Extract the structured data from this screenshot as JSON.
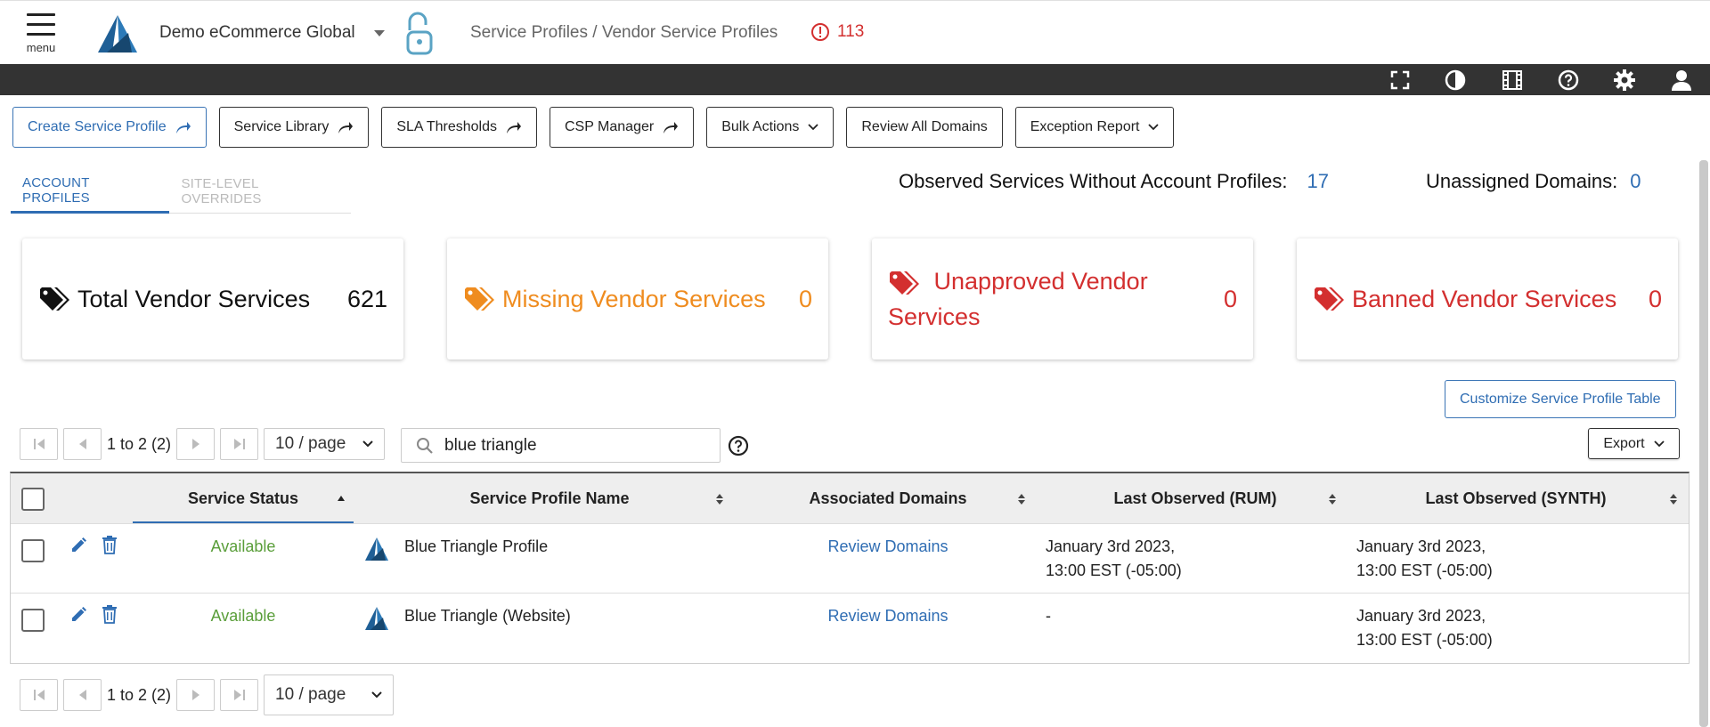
{
  "header": {
    "menu_label": "menu",
    "org_name": "Demo eCommerce Global",
    "breadcrumb": "Service Profiles / Vendor Service Profiles",
    "alert_count": "113",
    "icons": [
      "fullscreen-icon",
      "contrast-icon",
      "film-icon",
      "help-icon",
      "settings-icon",
      "user-icon"
    ]
  },
  "toolbar": {
    "create": "Create Service Profile",
    "library": "Service Library",
    "sla": "SLA Thresholds",
    "csp": "CSP Manager",
    "bulk": "Bulk Actions",
    "review_all": "Review All Domains",
    "exception": "Exception Report"
  },
  "tabs": {
    "account": "ACCOUNT PROFILES",
    "site": "SITE-LEVEL OVERRIDES"
  },
  "summary": {
    "observed_label": "Observed Services Without Account Profiles:",
    "observed_value": "17",
    "unassigned_label": "Unassigned Domains:",
    "unassigned_value": "0"
  },
  "cards": {
    "total": {
      "label": "Total Vendor Services",
      "value": "621"
    },
    "missing": {
      "label": "Missing Vendor Services",
      "value": "0"
    },
    "unapproved": {
      "label": "Unapproved Vendor Services",
      "value": "0"
    },
    "banned": {
      "label": "Banned Vendor Services",
      "value": "0"
    }
  },
  "customize_label": "Customize Service Profile Table",
  "pager": {
    "range": "1 to 2 (2)",
    "page_size": "10 / page"
  },
  "search": {
    "value": "blue triangle"
  },
  "export_label": "Export",
  "table": {
    "columns": {
      "status": "Service Status",
      "name": "Service Profile Name",
      "domains": "Associated Domains",
      "rum": "Last Observed (RUM)",
      "synth": "Last Observed (SYNTH)"
    },
    "rows": [
      {
        "status": "Available",
        "name": "Blue Triangle Profile",
        "domains": "Review Domains",
        "rum_1": "January 3rd 2023,",
        "rum_2": "13:00 EST (-05:00)",
        "synth_1": "January 3rd 2023,",
        "synth_2": "13:00 EST (-05:00)"
      },
      {
        "status": "Available",
        "name": "Blue Triangle (Website)",
        "domains": "Review Domains",
        "rum_1": "-",
        "rum_2": "",
        "synth_1": "January 3rd 2023,",
        "synth_2": "13:00 EST (-05:00)"
      }
    ]
  },
  "colors": {
    "accent": "#2f6db3",
    "dark_bar": "#333333",
    "alert": "#d32f2f",
    "warning": "#ef8c1f",
    "available": "#5a9e3a"
  }
}
